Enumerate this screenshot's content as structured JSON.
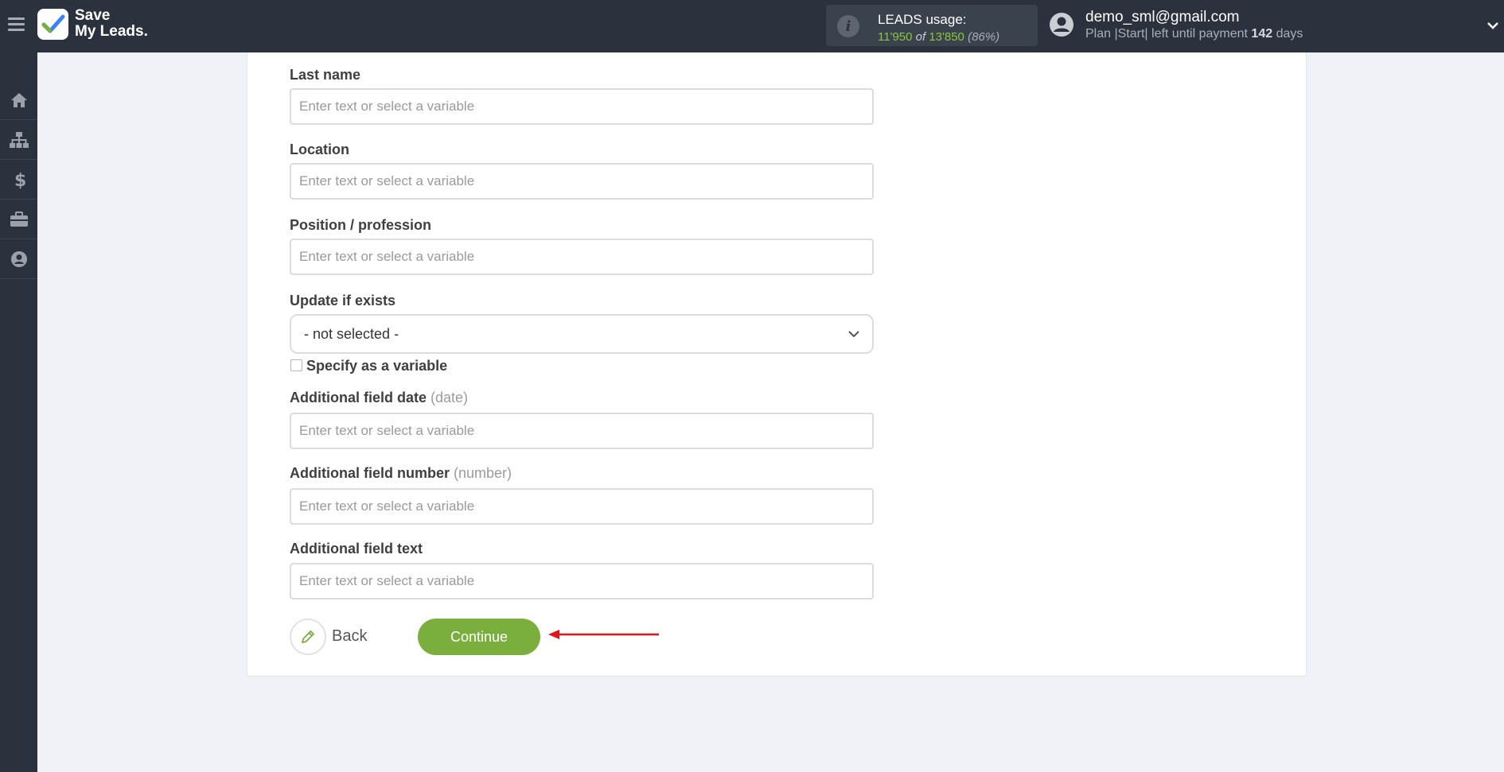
{
  "app": {
    "logo_line1": "Save",
    "logo_line2": "My Leads."
  },
  "usage": {
    "title": "LEADS usage:",
    "used": "11'950",
    "of_word": "of",
    "total": "13'850",
    "percent": "(86%)"
  },
  "account": {
    "email": "demo_sml@gmail.com",
    "plan_prefix": "Plan |Start| left until payment",
    "days": "142",
    "days_suffix": "days"
  },
  "sidebar": {
    "items": [
      "home-icon",
      "sitemap-icon",
      "dollar-icon",
      "briefcase-icon",
      "user-circle-icon"
    ]
  },
  "form": {
    "last_name": {
      "label": "Last name",
      "placeholder": "Enter text or select a variable"
    },
    "location": {
      "label": "Location",
      "placeholder": "Enter text or select a variable"
    },
    "position": {
      "label": "Position / profession",
      "placeholder": "Enter text or select a variable"
    },
    "update_if_exists": {
      "label": "Update if exists",
      "value": "- not selected -"
    },
    "specify_variable": {
      "label": "Specify as a variable",
      "checked": false
    },
    "add_date": {
      "label": "Additional field date",
      "hint": "(date)",
      "placeholder": "Enter text or select a variable"
    },
    "add_number": {
      "label": "Additional field number",
      "hint": "(number)",
      "placeholder": "Enter text or select a variable"
    },
    "add_text": {
      "label": "Additional field text",
      "placeholder": "Enter text or select a variable"
    }
  },
  "actions": {
    "back_label": "Back",
    "continue_label": "Continue"
  },
  "colors": {
    "accent_green": "#7aaf3e",
    "topbar": "#2b323d",
    "annotation_arrow": "#e3151a"
  }
}
